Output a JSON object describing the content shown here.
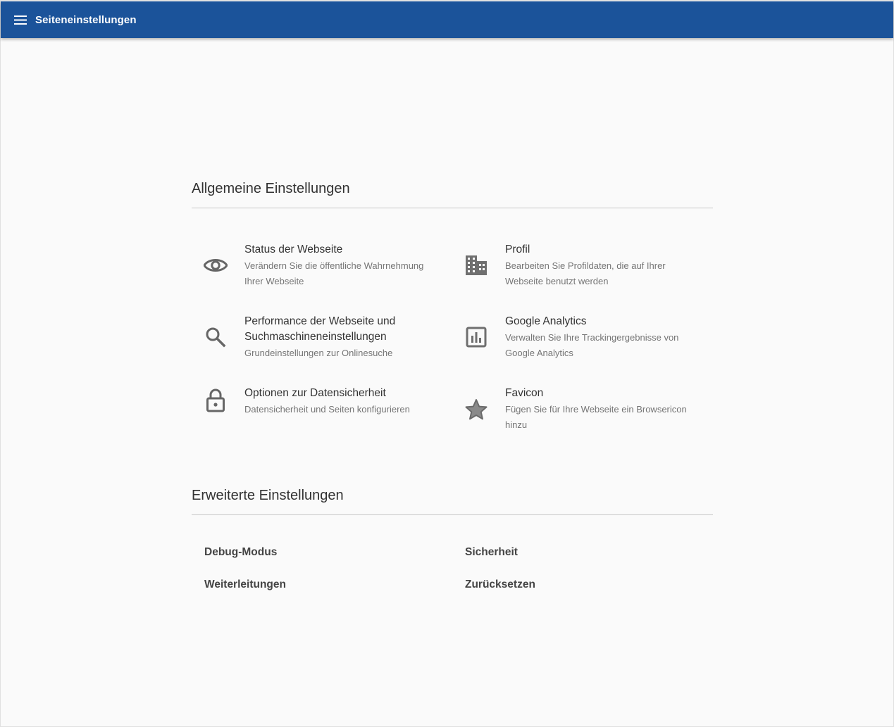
{
  "appbar": {
    "title": "Seiteneinstellungen",
    "menu_icon": "menu-icon",
    "color": "#1b539a"
  },
  "general": {
    "heading": "Allgemeine Einstellungen",
    "items": [
      {
        "title": "Status der Webseite",
        "desc": "Verändern Sie die öffentliche Wahrnehmung Ihrer Webseite",
        "icon": "eye-icon"
      },
      {
        "title": "Profil",
        "desc": "Bearbeiten Sie Profildaten, die auf Ihrer Webseite benutzt werden",
        "icon": "building-icon"
      },
      {
        "title": "Performance der Webseite und Suchmaschineneinstellungen",
        "desc": "Grundeinstellungen zur Onlinesuche",
        "icon": "search-icon"
      },
      {
        "title": "Google Analytics",
        "desc": "Verwalten Sie Ihre Trackingergebnisse von Google Analytics",
        "icon": "bar-chart-icon"
      },
      {
        "title": "Optionen zur Datensicherheit",
        "desc": "Datensicherheit und Seiten konfigurieren",
        "icon": "lock-icon"
      },
      {
        "title": "Favicon",
        "desc": "Fügen Sie für Ihre Webseite ein Browsericon hinzu",
        "icon": "star-icon"
      }
    ]
  },
  "advanced": {
    "heading": "Erweiterte Einstellungen",
    "items": [
      {
        "label": "Debug-Modus"
      },
      {
        "label": "Sicherheit"
      },
      {
        "label": "Weiterleitungen"
      },
      {
        "label": "Zurücksetzen"
      }
    ]
  }
}
